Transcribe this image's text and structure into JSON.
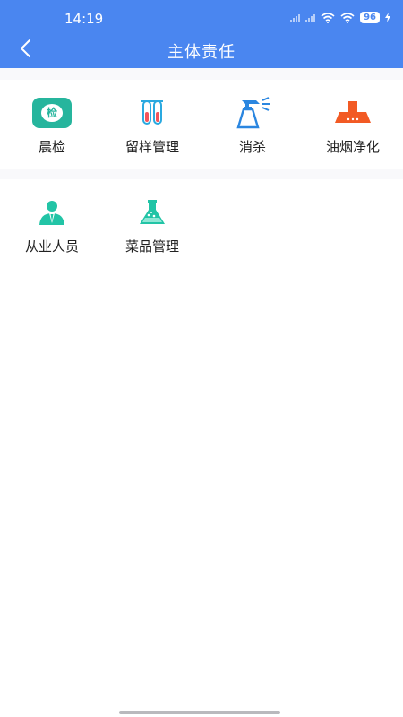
{
  "status_bar": {
    "time": "14:19",
    "battery": "96"
  },
  "header": {
    "title": "主体责任",
    "back_icon": "chevron-left-icon"
  },
  "section1": {
    "items": [
      {
        "label": "晨检",
        "icon": "inspection-badge-icon",
        "icon_text": "检",
        "color": "#26b59d"
      },
      {
        "label": "留样管理",
        "icon": "test-tubes-icon",
        "color": "#2aa9e0"
      },
      {
        "label": "消杀",
        "icon": "spray-bottle-icon",
        "color": "#2a86e0"
      },
      {
        "label": "油烟净化",
        "icon": "range-hood-icon",
        "color": "#f25a24"
      }
    ]
  },
  "section2": {
    "items": [
      {
        "label": "从业人员",
        "icon": "staff-person-icon",
        "color": "#22c4a6"
      },
      {
        "label": "菜品管理",
        "icon": "flask-icon",
        "color": "#22c4a6"
      }
    ]
  }
}
